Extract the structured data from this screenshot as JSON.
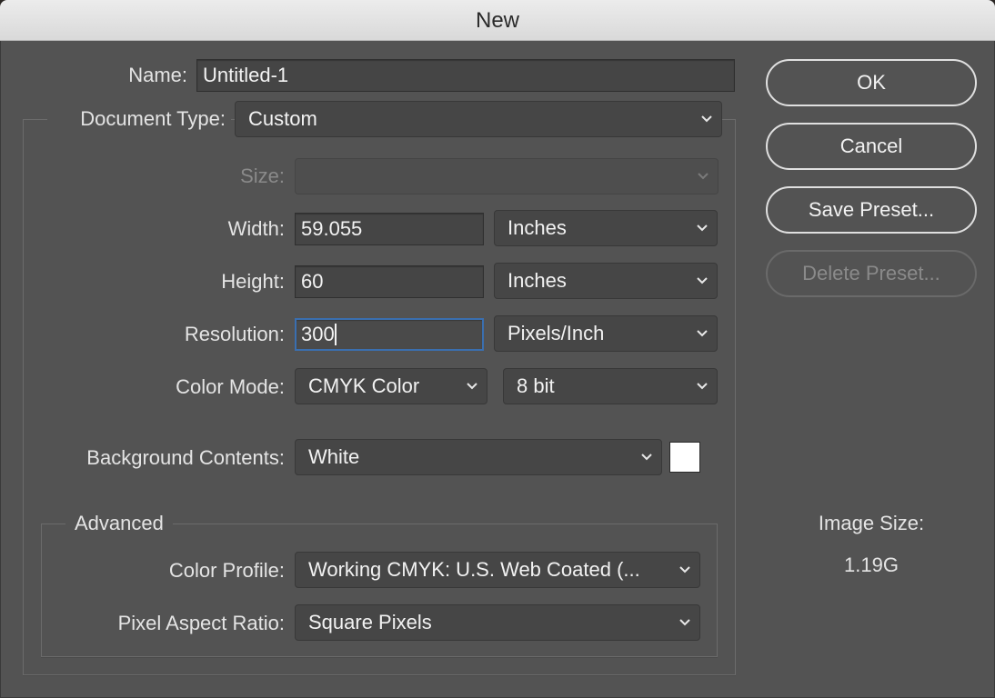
{
  "window": {
    "title": "New"
  },
  "name": {
    "label": "Name:",
    "value": "Untitled-1"
  },
  "document_type": {
    "label": "Document Type:",
    "value": "Custom"
  },
  "size": {
    "label": "Size:",
    "value": ""
  },
  "width": {
    "label": "Width:",
    "value": "59.055",
    "unit": "Inches"
  },
  "height": {
    "label": "Height:",
    "value": "60",
    "unit": "Inches"
  },
  "resolution": {
    "label": "Resolution:",
    "value": "300",
    "unit": "Pixels/Inch"
  },
  "color_mode": {
    "label": "Color Mode:",
    "value": "CMYK Color",
    "depth": "8 bit"
  },
  "background": {
    "label": "Background Contents:",
    "value": "White",
    "swatch_color": "#ffffff"
  },
  "advanced": {
    "legend": "Advanced",
    "color_profile": {
      "label": "Color Profile:",
      "value": "Working CMYK:  U.S. Web Coated (..."
    },
    "pixel_aspect": {
      "label": "Pixel Aspect Ratio:",
      "value": "Square Pixels"
    }
  },
  "buttons": {
    "ok": "OK",
    "cancel": "Cancel",
    "save_preset": "Save Preset...",
    "delete_preset": "Delete Preset..."
  },
  "image_size": {
    "label": "Image Size:",
    "value": "1.19G"
  },
  "colors": {
    "dialog_bg": "#535353",
    "focus_ring": "#3a6fb0"
  }
}
